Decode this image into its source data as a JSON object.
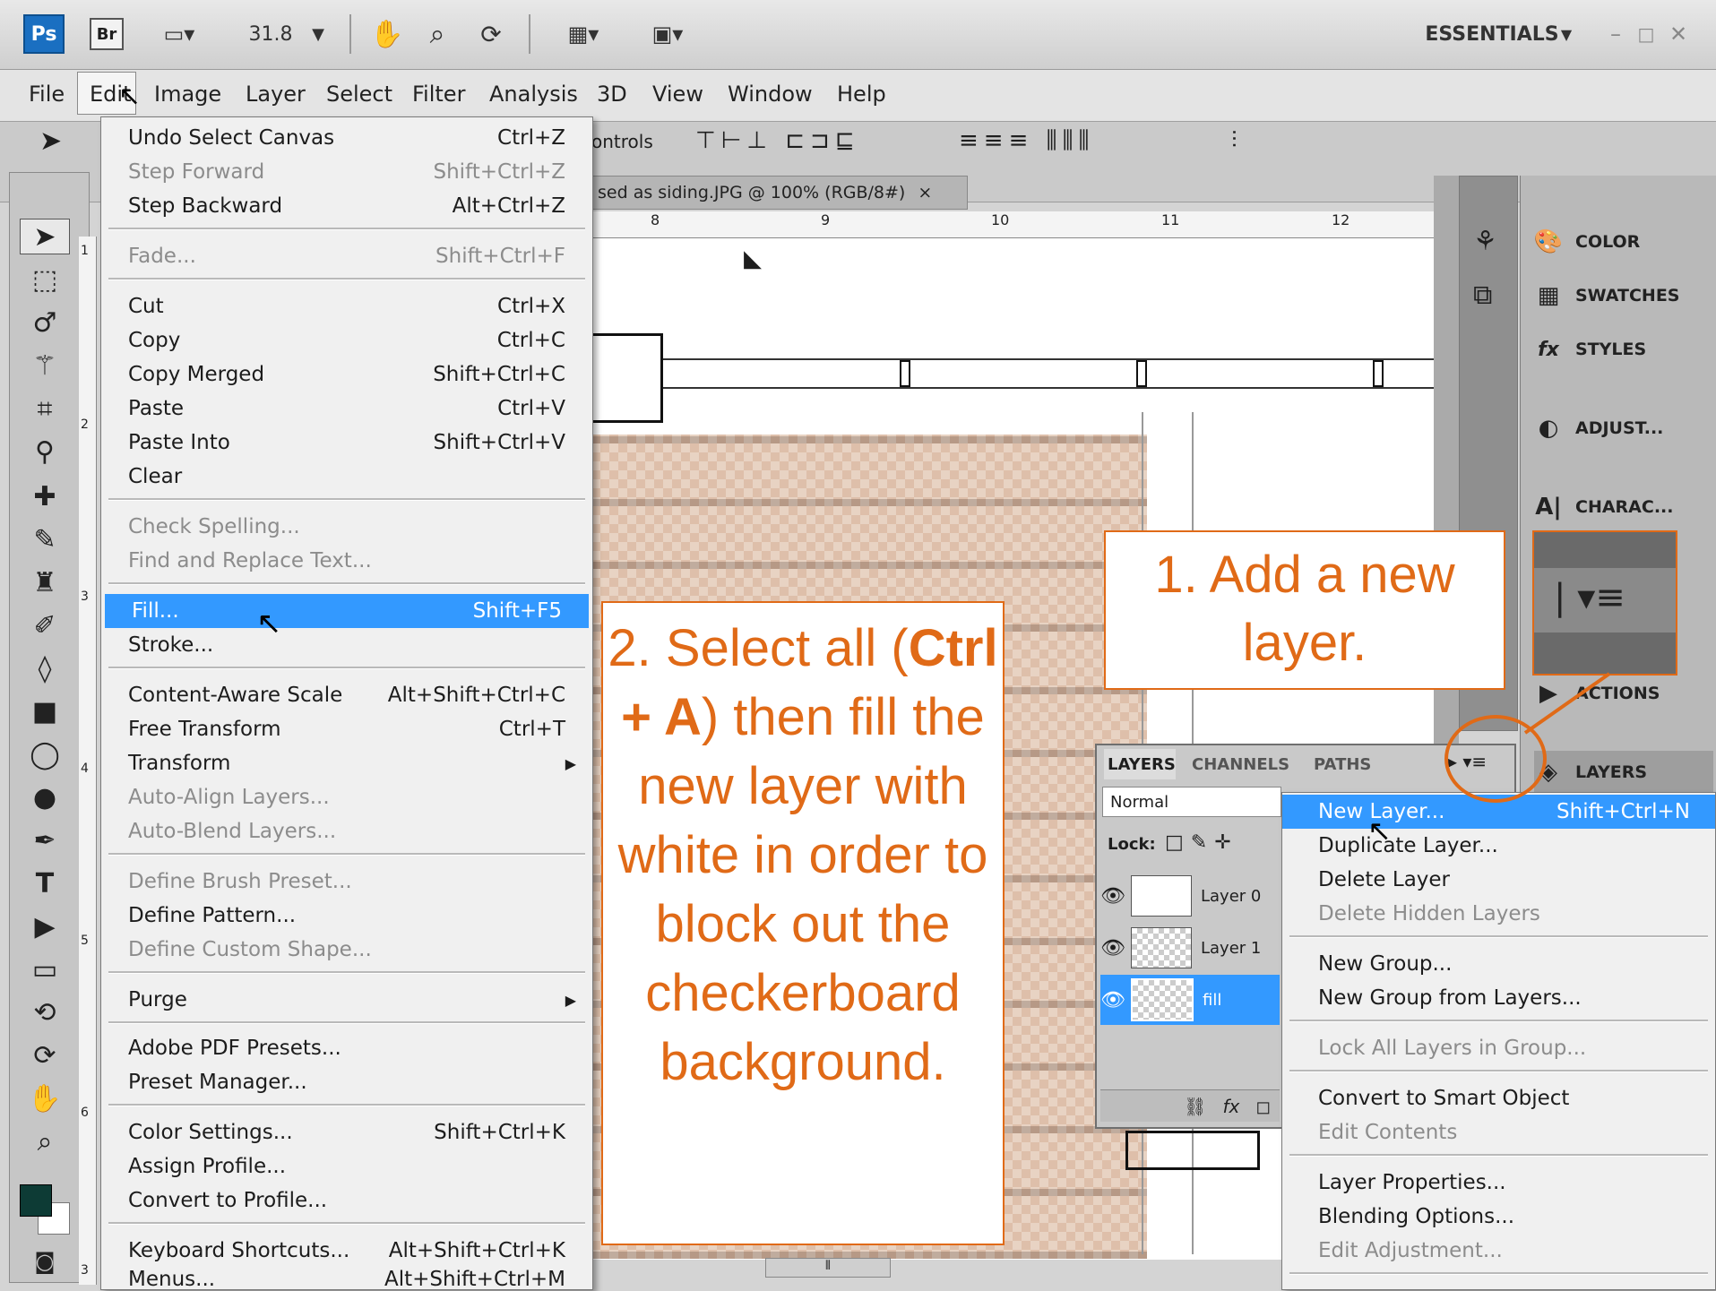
{
  "titlebar": {
    "ps": "Ps",
    "br": "Br",
    "zoom": "31.8",
    "workspace": "ESSENTIALS"
  },
  "menubar": [
    "File",
    "Edit",
    "Image",
    "Layer",
    "Select",
    "Filter",
    "Analysis",
    "3D",
    "View",
    "Window",
    "Help"
  ],
  "options": {
    "controls": "ontrols"
  },
  "document": {
    "tab": "sed as siding.JPG @ 100% (RGB/8#)",
    "close": "×",
    "ruler_h": [
      "8",
      "9",
      "10",
      "11",
      "12"
    ],
    "ruler_v": [
      "1",
      "2",
      "3",
      "4",
      "5",
      "6",
      "3"
    ]
  },
  "panels": [
    {
      "label": "COLOR",
      "icon": "palette-icon"
    },
    {
      "label": "SWATCHES",
      "icon": "grid-icon"
    },
    {
      "label": "STYLES",
      "icon": "fx-icon"
    },
    {
      "label": "ADJUST...",
      "icon": "adjust-icon"
    },
    {
      "label": "CHARAC...",
      "icon": "character-icon"
    },
    {
      "label": "ACTIONS",
      "icon": "play-icon"
    },
    {
      "label": "LAYERS",
      "icon": "layers-icon"
    }
  ],
  "layers_panel": {
    "tabs": [
      "LAYERS",
      "CHANNELS",
      "PATHS"
    ],
    "blend_mode": "Normal",
    "lock_label": "Lock:",
    "layers": [
      {
        "name": "Layer 0"
      },
      {
        "name": "Layer 1"
      },
      {
        "name": "fill"
      }
    ]
  },
  "edit_menu": [
    {
      "label": "Undo Select Canvas",
      "shortcut": "Ctrl+Z"
    },
    {
      "label": "Step Forward",
      "shortcut": "Shift+Ctrl+Z",
      "disabled": true
    },
    {
      "label": "Step Backward",
      "shortcut": "Alt+Ctrl+Z"
    },
    {
      "label": "Fade...",
      "shortcut": "Shift+Ctrl+F",
      "disabled": true
    },
    {
      "label": "Cut",
      "shortcut": "Ctrl+X"
    },
    {
      "label": "Copy",
      "shortcut": "Ctrl+C"
    },
    {
      "label": "Copy Merged",
      "shortcut": "Shift+Ctrl+C"
    },
    {
      "label": "Paste",
      "shortcut": "Ctrl+V"
    },
    {
      "label": "Paste Into",
      "shortcut": "Shift+Ctrl+V"
    },
    {
      "label": "Clear",
      "shortcut": ""
    },
    {
      "label": "Check Spelling...",
      "shortcut": "",
      "disabled": true
    },
    {
      "label": "Find and Replace Text...",
      "shortcut": "",
      "disabled": true
    },
    {
      "label": "Fill...",
      "shortcut": "Shift+F5",
      "highlighted": true
    },
    {
      "label": "Stroke...",
      "shortcut": ""
    },
    {
      "label": "Content-Aware Scale",
      "shortcut": "Alt+Shift+Ctrl+C"
    },
    {
      "label": "Free Transform",
      "shortcut": "Ctrl+T"
    },
    {
      "label": "Transform",
      "shortcut": "",
      "submenu": true
    },
    {
      "label": "Auto-Align Layers...",
      "shortcut": "",
      "disabled": true
    },
    {
      "label": "Auto-Blend Layers...",
      "shortcut": "",
      "disabled": true
    },
    {
      "label": "Define Brush Preset...",
      "shortcut": "",
      "disabled": true
    },
    {
      "label": "Define Pattern...",
      "shortcut": ""
    },
    {
      "label": "Define Custom Shape...",
      "shortcut": "",
      "disabled": true
    },
    {
      "label": "Purge",
      "shortcut": "",
      "submenu": true
    },
    {
      "label": "Adobe PDF Presets...",
      "shortcut": ""
    },
    {
      "label": "Preset Manager...",
      "shortcut": ""
    },
    {
      "label": "Color Settings...",
      "shortcut": "Shift+Ctrl+K"
    },
    {
      "label": "Assign Profile...",
      "shortcut": ""
    },
    {
      "label": "Convert to Profile...",
      "shortcut": ""
    },
    {
      "label": "Keyboard Shortcuts...",
      "shortcut": "Alt+Shift+Ctrl+K"
    },
    {
      "label": "Menus...",
      "shortcut": "Alt+Shift+Ctrl+M"
    }
  ],
  "layer_menu": [
    {
      "label": "New Layer...",
      "shortcut": "Shift+Ctrl+N",
      "highlighted": true
    },
    {
      "label": "Duplicate Layer...",
      "shortcut": ""
    },
    {
      "label": "Delete Layer",
      "shortcut": ""
    },
    {
      "label": "Delete Hidden Layers",
      "shortcut": "",
      "disabled": true
    },
    {
      "label": "New Group...",
      "shortcut": ""
    },
    {
      "label": "New Group from Layers...",
      "shortcut": ""
    },
    {
      "label": "Lock All Layers in Group...",
      "shortcut": "",
      "disabled": true
    },
    {
      "label": "Convert to Smart Object",
      "shortcut": ""
    },
    {
      "label": "Edit Contents",
      "shortcut": "",
      "disabled": true
    },
    {
      "label": "Layer Properties...",
      "shortcut": ""
    },
    {
      "label": "Blending Options...",
      "shortcut": ""
    },
    {
      "label": "Edit Adjustment...",
      "shortcut": "",
      "disabled": true
    }
  ],
  "callouts": {
    "step1": "1. Add a new layer.",
    "step2_pre": "2. Select all (",
    "step2_bold": "Ctrl + A",
    "step2_post": ") then fill the new layer with white in order to block out the checkerboard background."
  },
  "colors": {
    "accent": "#e06a17",
    "highlight": "#3399ff",
    "foreground_swatch": "#0d3b35"
  }
}
